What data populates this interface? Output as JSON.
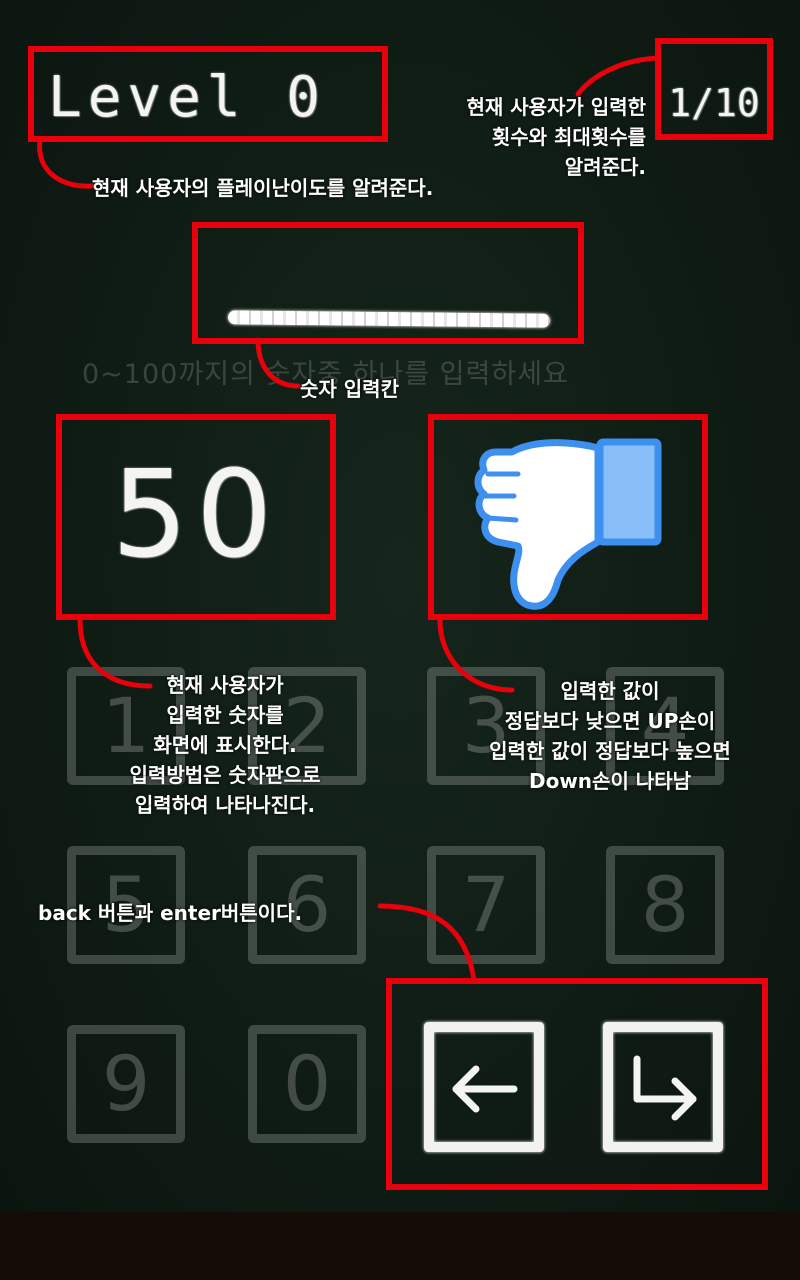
{
  "header": {
    "level_label": "Level 0",
    "attempt_counter": "1/10"
  },
  "input": {
    "placeholder": "0~100까지의 숫자중 하나를 입력하세요"
  },
  "display": {
    "current_number": "50",
    "hint_icon": "thumbs-down-icon",
    "hint_color": "#3d8ff0"
  },
  "keypad": {
    "keys": [
      {
        "label": "1"
      },
      {
        "label": "2"
      },
      {
        "label": "3"
      },
      {
        "label": "4"
      },
      {
        "label": "5"
      },
      {
        "label": "6"
      },
      {
        "label": "7"
      },
      {
        "label": "8"
      },
      {
        "label": "9"
      },
      {
        "label": "0"
      }
    ],
    "back_icon": "left-arrow-icon",
    "enter_icon": "enter-arrow-icon"
  },
  "annotations": {
    "level": "현재 사용자의 플레이난이도를 알려준다.",
    "counter": [
      "현재 사용자가 입력한",
      "횟수와 최대횟수를",
      "알려준다."
    ],
    "input": "숫자 입력칸",
    "number": [
      "현재 사용자가",
      "입력한 숫자를",
      "화면에 표시한다.",
      "입력방법은 숫자판으로",
      "입력하여 나타나진다."
    ],
    "hint": [
      "입력한 값이",
      "정답보다 낮으면 UP손이",
      "입력한 값이 정답보다 높으면",
      "Down손이 나타남"
    ],
    "buttons": "back 버튼과 enter버튼이다."
  },
  "colors": {
    "highlight": "#e8000b",
    "chalkboard": "#0f1c14",
    "chalk": "#f4f4f2"
  }
}
